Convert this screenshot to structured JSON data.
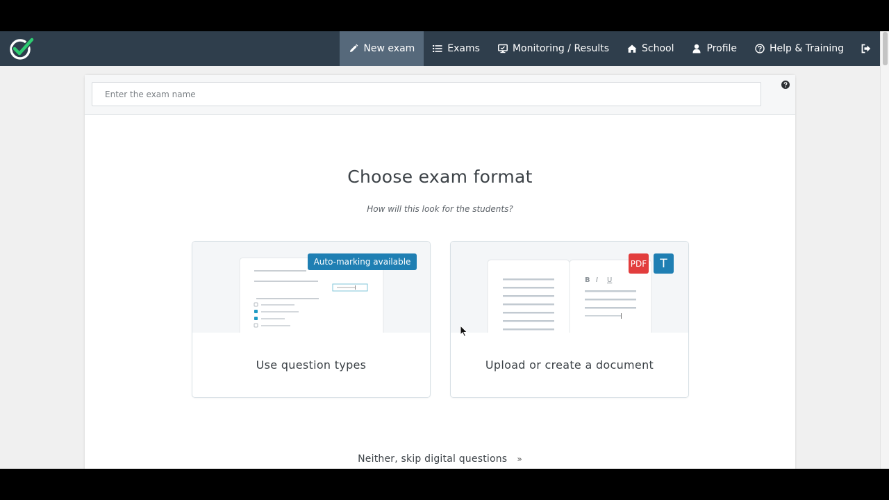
{
  "colors": {
    "navbar": "#2f3e4c",
    "nav_active": "#56697b",
    "accent_blue": "#1f7fb3",
    "pdf_red": "#e23d3d",
    "logo_green": "#2ecc71"
  },
  "navbar": {
    "logo_icon": "checkmark-circle-logo",
    "items": [
      {
        "label": "New exam",
        "icon": "pencil-icon",
        "active": true
      },
      {
        "label": "Exams",
        "icon": "list-icon"
      },
      {
        "label": "Monitoring / Results",
        "icon": "monitor-icon"
      },
      {
        "label": "School",
        "icon": "home-icon"
      },
      {
        "label": "Profile",
        "icon": "user-icon"
      },
      {
        "label": "Help & Training",
        "icon": "question-circle-icon"
      },
      {
        "label": "",
        "icon": "sign-out-icon"
      }
    ]
  },
  "exam_name": {
    "placeholder": "Enter the exam name",
    "value": ""
  },
  "main": {
    "title": "Choose exam format",
    "subtitle": "How will this look for the students?",
    "cards": [
      {
        "label": "Use question types",
        "badge": "Auto-marking available"
      },
      {
        "label": "Upload or create a document",
        "badges": [
          "PDF",
          "T"
        ],
        "toolbar": [
          "B",
          "I",
          "U"
        ]
      }
    ],
    "skip_link": "Neither, skip digital questions",
    "skip_icon": "double-chevron-right-icon"
  }
}
